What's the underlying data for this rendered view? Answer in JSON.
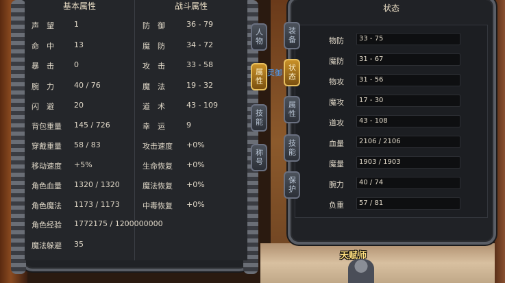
{
  "basic_panel": {
    "title": "基本属性",
    "rows": [
      {
        "label": "声　望",
        "value": "1"
      },
      {
        "label": "命　中",
        "value": "13"
      },
      {
        "label": "暴　击",
        "value": "0"
      },
      {
        "label": "腕　力",
        "value": "40 / 76"
      },
      {
        "label": "闪　避",
        "value": "20"
      },
      {
        "label": "背包重量",
        "value": "145 / 726"
      },
      {
        "label": "穿戴重量",
        "value": "58 / 83"
      },
      {
        "label": "移动速度",
        "value": "+5%"
      },
      {
        "label": "角色血量",
        "value": "1320 / 1320"
      },
      {
        "label": "角色魔法",
        "value": "1173 / 1173"
      },
      {
        "label": "角色经验",
        "value": "1772175 / 1200000000"
      },
      {
        "label": "魔法躲避",
        "value": "35"
      }
    ]
  },
  "combat_panel": {
    "title": "战斗属性",
    "rows": [
      {
        "label": "防　御",
        "value": "36 - 79"
      },
      {
        "label": "魔　防",
        "value": "34 - 72"
      },
      {
        "label": "攻　击",
        "value": "33 - 58"
      },
      {
        "label": "魔　法",
        "value": "19 - 32"
      },
      {
        "label": "道　术",
        "value": "43 - 109"
      },
      {
        "label": "幸　运",
        "value": "9"
      },
      {
        "label": "攻击速度",
        "value": "+0%"
      },
      {
        "label": "生命恢复",
        "value": "+0%"
      },
      {
        "label": "魔法恢复",
        "value": "+0%"
      },
      {
        "label": "中毒恢复",
        "value": "+0%"
      }
    ]
  },
  "left_tabs": [
    {
      "label": "人物",
      "active": false
    },
    {
      "label": "属性",
      "active": true
    },
    {
      "label": "技能",
      "active": false
    },
    {
      "label": "称号",
      "active": false
    }
  ],
  "right_tabs": [
    {
      "label": "装备",
      "active": false
    },
    {
      "label": "状态",
      "active": true
    },
    {
      "label": "属性",
      "active": false
    },
    {
      "label": "技能",
      "active": false
    },
    {
      "label": "保护",
      "active": false
    }
  ],
  "status_panel": {
    "title": "状态",
    "rows": [
      {
        "label": "物防",
        "value": "33 - 75"
      },
      {
        "label": "魔防",
        "value": "31 - 67"
      },
      {
        "label": "物攻",
        "value": "31 - 56"
      },
      {
        "label": "魔攻",
        "value": "17 - 30"
      },
      {
        "label": "道攻",
        "value": "43 - 108"
      },
      {
        "label": "血量",
        "value": "2106 / 2106"
      },
      {
        "label": "魔量",
        "value": "1903 / 1903"
      },
      {
        "label": "腕力",
        "value": "40 / 74"
      },
      {
        "label": "负重",
        "value": "57 / 81"
      }
    ]
  },
  "scene": {
    "talent_label": "天赋师",
    "blue_text": "灵御"
  }
}
